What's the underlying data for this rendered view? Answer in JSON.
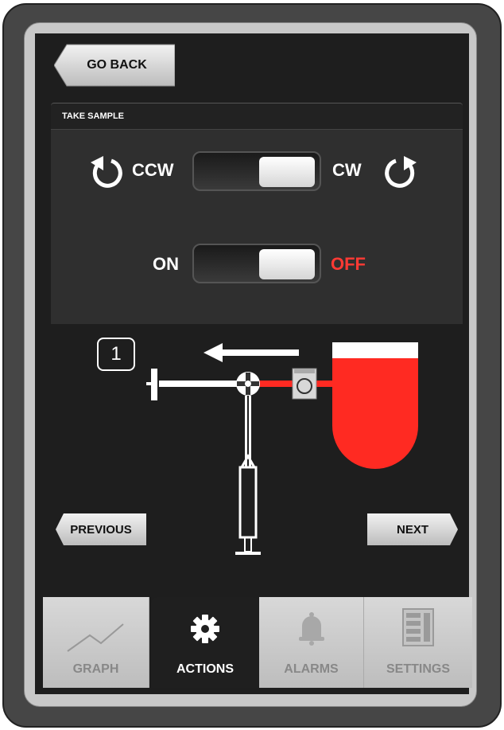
{
  "header": {
    "back_label": "GO BACK"
  },
  "panel": {
    "title": "TAKE SAMPLE",
    "direction": {
      "left_label": "CCW",
      "right_label": "CW",
      "left_icon": "rotate-ccw-icon",
      "right_icon": "rotate-cw-icon",
      "state": "CW"
    },
    "power": {
      "left_label": "ON",
      "right_label": "OFF",
      "state": "OFF"
    }
  },
  "diagram": {
    "step_number": "1",
    "flow_direction": "left",
    "colors": {
      "fluid": "#ff2a22",
      "pipe": "#ffffff"
    }
  },
  "navigation": {
    "previous_label": "PREVIOUS",
    "next_label": "NEXT"
  },
  "tabs": [
    {
      "label": "GRAPH",
      "icon": "graph-icon",
      "active": false
    },
    {
      "label": "ACTIONS",
      "icon": "gear-icon",
      "active": true
    },
    {
      "label": "ALARMS",
      "icon": "bell-icon",
      "active": false
    },
    {
      "label": "SETTINGS",
      "icon": "settings-panel-icon",
      "active": false
    }
  ],
  "colors": {
    "accent_red": "#ff3a34",
    "screen_bg": "#1e1e1e"
  }
}
